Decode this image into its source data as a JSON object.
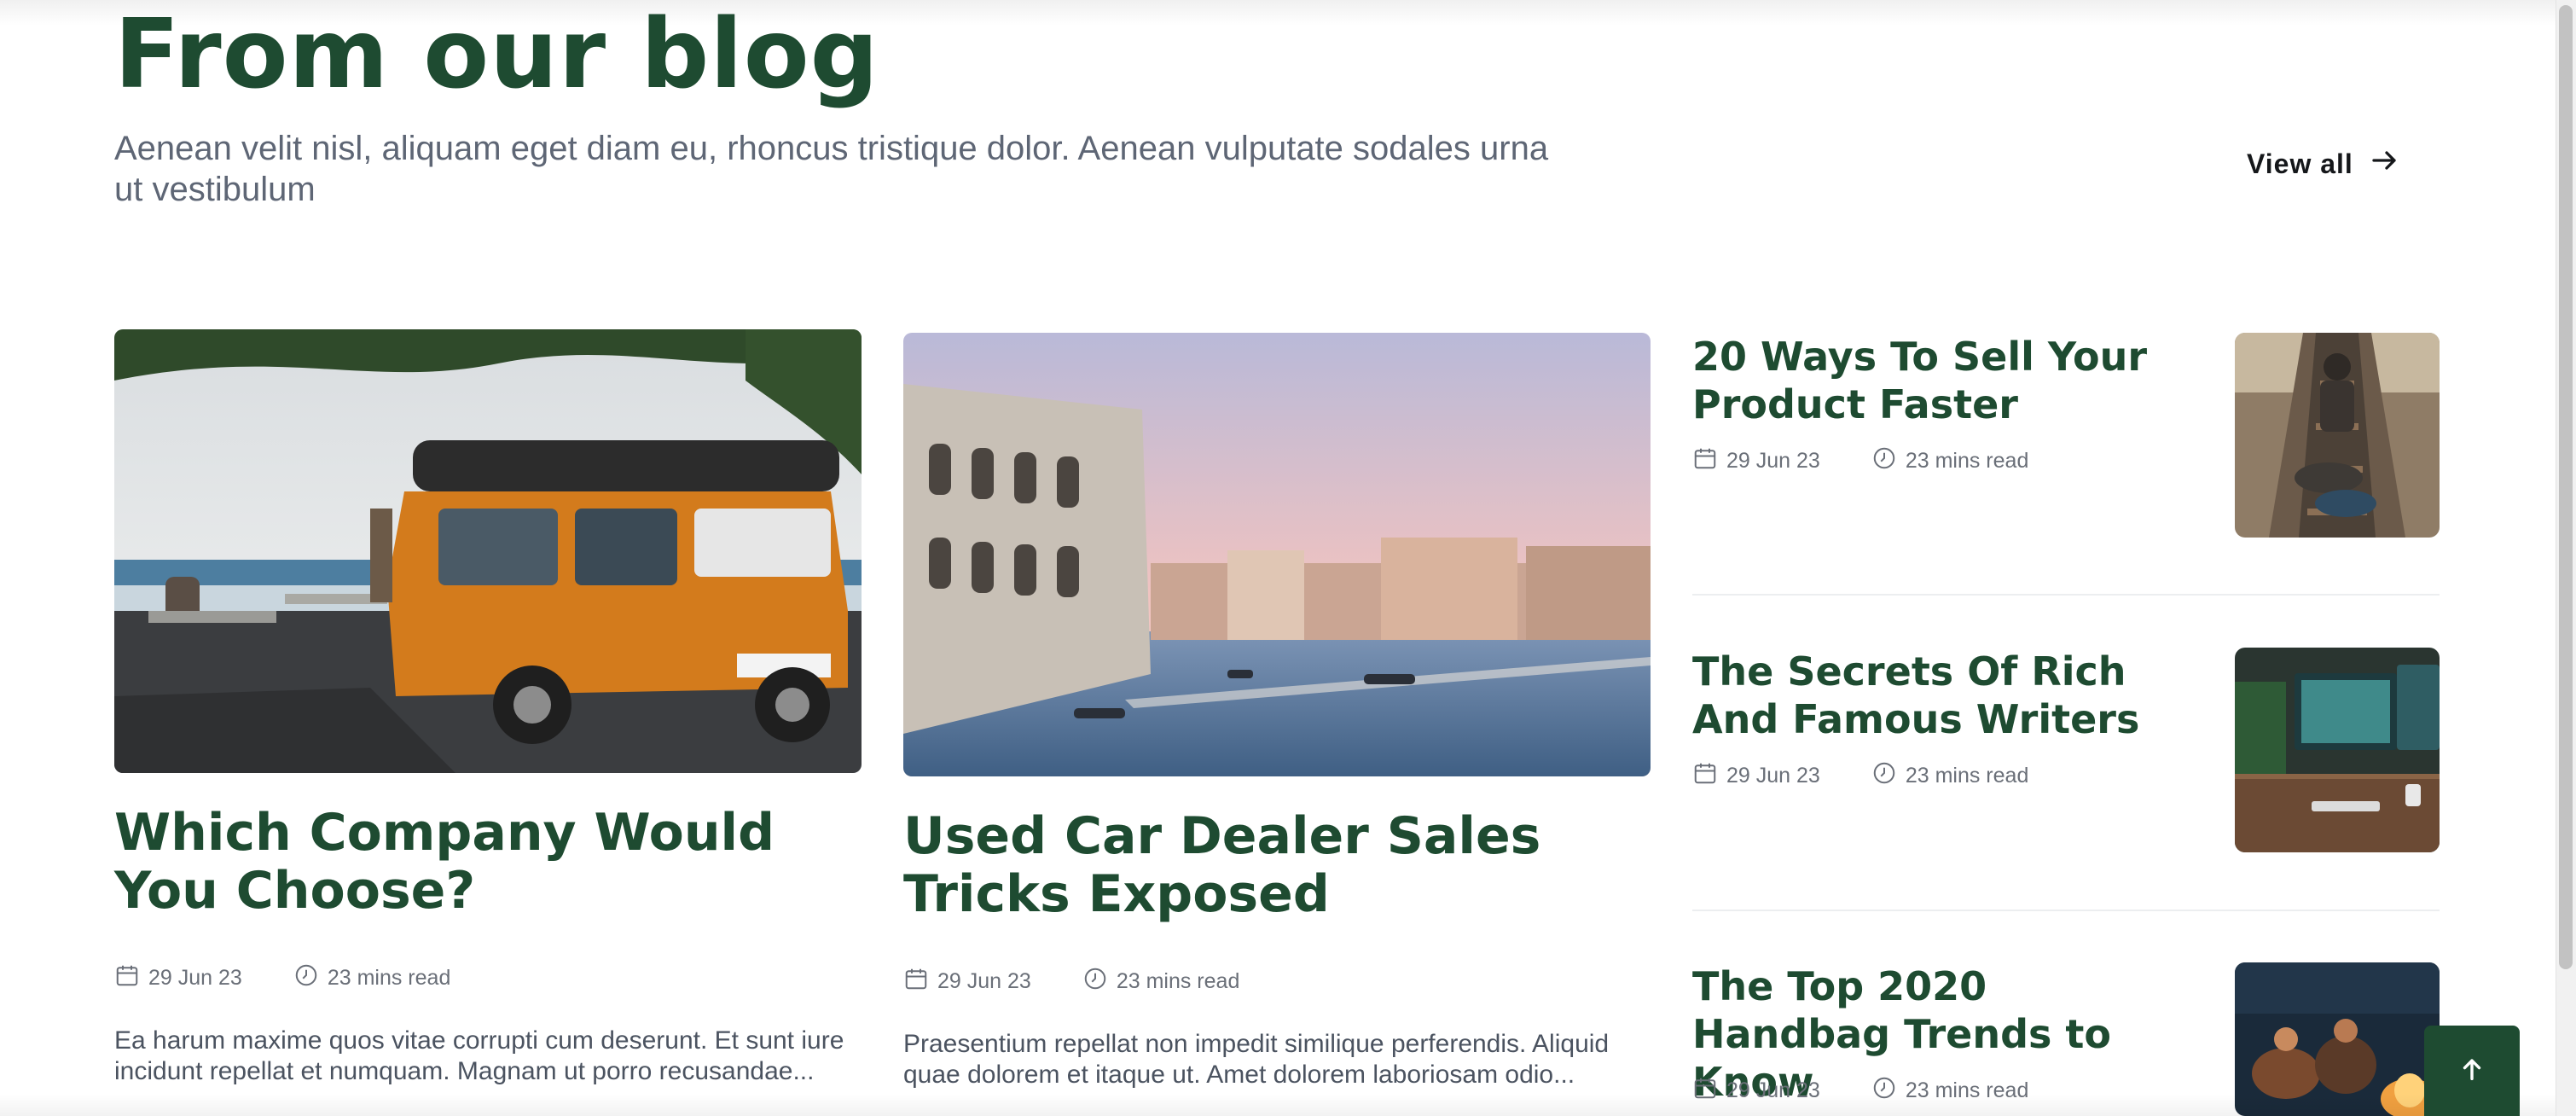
{
  "section": {
    "title": "From our blog",
    "subtitle": "Aenean velit nisl, aliquam eget diam eu, rhoncus tristique dolor. Aenean vulputate sodales urna ut vestibulum",
    "view_all_label": "View all"
  },
  "featured_posts": [
    {
      "title": "Which Company Would You Choose?",
      "date": "29 Jun 23",
      "read_time": "23 mins read",
      "excerpt": "Ea harum maxime quos vitae corrupti cum deserunt. Et sunt iure incidunt repellat et numquam. Magnam ut porro recusandae..."
    },
    {
      "title": "Used Car Dealer Sales Tricks Exposed",
      "date": "29 Jun 23",
      "read_time": "23 mins read",
      "excerpt": "Praesentium repellat non impedit similique perferendis. Aliquid quae dolorem et itaque ut. Amet dolorem laboriosam odio..."
    }
  ],
  "side_posts": [
    {
      "title": "20 Ways To Sell Your Product Faster",
      "date": "29 Jun 23",
      "read_time": "23 mins read"
    },
    {
      "title": "The Secrets Of Rich And Famous Writers",
      "date": "29 Jun 23",
      "read_time": "23 mins read"
    },
    {
      "title": "The Top 2020 Handbag Trends to Know",
      "date": "29 Jun 23",
      "read_time": "23 mins read"
    }
  ],
  "icons": {
    "view_all": "arrow-right-icon",
    "date": "calendar-icon",
    "read_time": "clock-icon",
    "back_to_top": "arrow-up-icon"
  },
  "colors": {
    "heading_green": "#1e4b31",
    "body_text": "#4b5360",
    "meta_text": "#6a6f78",
    "back_to_top_bg": "#1e4b31"
  }
}
